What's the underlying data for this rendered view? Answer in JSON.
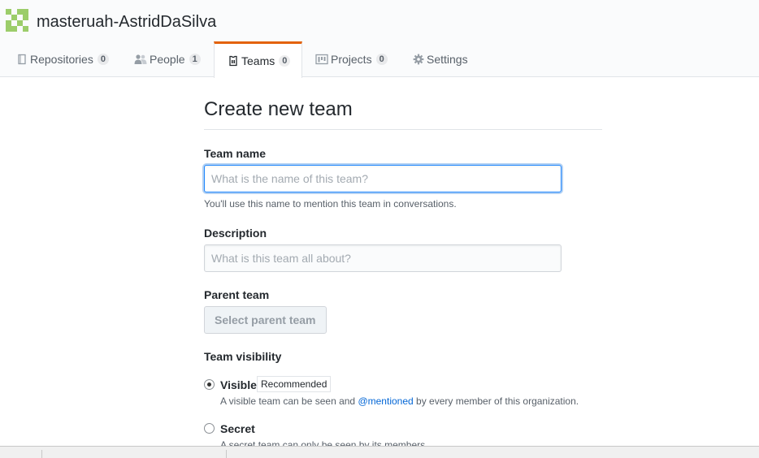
{
  "org": {
    "name": "masteruah-AstridDaSilva"
  },
  "tabs": [
    {
      "label": "Repositories",
      "count": "0",
      "icon": "repo-icon"
    },
    {
      "label": "People",
      "count": "1",
      "icon": "people-icon"
    },
    {
      "label": "Teams",
      "count": "0",
      "icon": "jersey-icon",
      "selected": true
    },
    {
      "label": "Projects",
      "count": "0",
      "icon": "project-icon"
    },
    {
      "label": "Settings",
      "icon": "gear-icon"
    }
  ],
  "form": {
    "title": "Create new team",
    "team_name": {
      "label": "Team name",
      "placeholder": "What is the name of this team?",
      "value": "",
      "note": "You'll use this name to mention this team in conversations."
    },
    "description": {
      "label": "Description",
      "placeholder": "What is this team all about?",
      "value": ""
    },
    "parent_team": {
      "label": "Parent team",
      "button": "Select parent team"
    },
    "visibility": {
      "label": "Team visibility",
      "options": [
        {
          "label": "Visible",
          "badge": "Recommended",
          "desc_before": "A visible team can be seen and ",
          "desc_link": "@mentioned",
          "desc_after": " by every member of this organization.",
          "checked": true
        },
        {
          "label": "Secret",
          "desc_before": "A secret team can only be seen by its members.",
          "checked": false
        }
      ]
    }
  },
  "colors": {
    "accent_tab_border": "#e36209",
    "link": "#0366d6",
    "focus_border": "#2188ff",
    "avatar_green": "#9ccd6a"
  }
}
